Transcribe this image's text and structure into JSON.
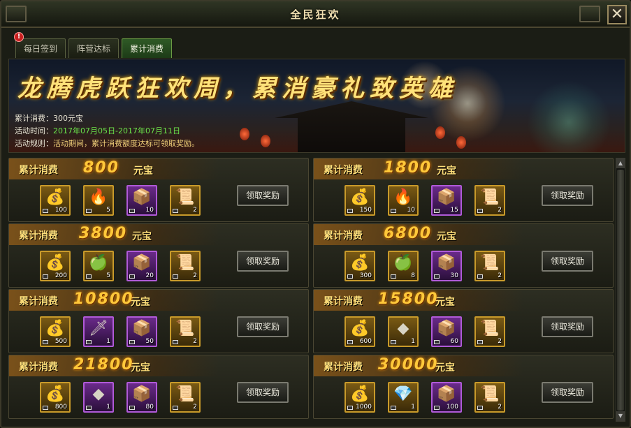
{
  "window": {
    "title": "全民狂欢",
    "close_glyph": "✕"
  },
  "tabs": [
    {
      "label": "每日签到",
      "active": false,
      "alert": true
    },
    {
      "label": "阵营达标",
      "active": false
    },
    {
      "label": "累计消费",
      "active": true
    }
  ],
  "alert_glyph": "!",
  "banner": {
    "title": "龙腾虎跃狂欢周，累消豪礼致英雄",
    "spent_label": "累计消费：",
    "spent_value": "300元宝",
    "time_label": "活动时间：",
    "time_value": "2017年07月05日-2017年07月11日",
    "rule_label": "活动规则：",
    "rule_value": "活动期间，累计消费额度达标可领取奖励。"
  },
  "tier_label": "累计消费",
  "unit": "元宝",
  "claim_label": "领取奖励",
  "tiers": [
    {
      "amount": "800",
      "items": [
        {
          "icon": "gold-ingot-icon",
          "glyph": "💰",
          "count": "100",
          "color": "gold"
        },
        {
          "icon": "fire-orb-icon",
          "glyph": "🔥",
          "count": "5",
          "color": "gold"
        },
        {
          "icon": "crate-icon",
          "glyph": "📦",
          "count": "10",
          "color": "purple"
        },
        {
          "icon": "scroll-icon",
          "glyph": "📜",
          "count": "2",
          "color": "gold"
        }
      ]
    },
    {
      "amount": "1800",
      "items": [
        {
          "icon": "gold-ingot-icon",
          "glyph": "💰",
          "count": "150",
          "color": "gold"
        },
        {
          "icon": "fire-orb-icon",
          "glyph": "🔥",
          "count": "10",
          "color": "gold"
        },
        {
          "icon": "crate-icon",
          "glyph": "📦",
          "count": "15",
          "color": "purple"
        },
        {
          "icon": "scroll-icon",
          "glyph": "📜",
          "count": "2",
          "color": "gold"
        }
      ]
    },
    {
      "amount": "3800",
      "items": [
        {
          "icon": "gold-ingot-icon",
          "glyph": "💰",
          "count": "200",
          "color": "gold"
        },
        {
          "icon": "golden-apple-icon",
          "glyph": "🍏",
          "count": "5",
          "color": "gold"
        },
        {
          "icon": "crate-icon",
          "glyph": "📦",
          "count": "20",
          "color": "purple"
        },
        {
          "icon": "scroll-icon",
          "glyph": "📜",
          "count": "2",
          "color": "gold"
        }
      ]
    },
    {
      "amount": "6800",
      "items": [
        {
          "icon": "gold-ingot-icon",
          "glyph": "💰",
          "count": "300",
          "color": "gold"
        },
        {
          "icon": "golden-apple-icon",
          "glyph": "🍏",
          "count": "8",
          "color": "gold"
        },
        {
          "icon": "crate-icon",
          "glyph": "📦",
          "count": "30",
          "color": "purple"
        },
        {
          "icon": "scroll-icon",
          "glyph": "📜",
          "count": "2",
          "color": "gold"
        }
      ]
    },
    {
      "amount": "10800",
      "items": [
        {
          "icon": "gold-ingot-icon",
          "glyph": "💰",
          "count": "500",
          "color": "gold"
        },
        {
          "icon": "dagger-icon",
          "glyph": "🗡",
          "count": "1",
          "color": "purple"
        },
        {
          "icon": "crate-icon",
          "glyph": "📦",
          "count": "50",
          "color": "purple"
        },
        {
          "icon": "scroll-icon",
          "glyph": "📜",
          "count": "2",
          "color": "gold"
        }
      ]
    },
    {
      "amount": "15800",
      "items": [
        {
          "icon": "gold-ingot-icon",
          "glyph": "💰",
          "count": "600",
          "color": "gold"
        },
        {
          "icon": "silver-cube-icon",
          "glyph": "◆",
          "count": "1",
          "color": "gold"
        },
        {
          "icon": "crate-icon",
          "glyph": "📦",
          "count": "60",
          "color": "purple"
        },
        {
          "icon": "scroll-icon",
          "glyph": "📜",
          "count": "2",
          "color": "gold"
        }
      ]
    },
    {
      "amount": "21800",
      "items": [
        {
          "icon": "gold-ingot-icon",
          "glyph": "💰",
          "count": "800",
          "color": "gold"
        },
        {
          "icon": "blue-crystal-icon",
          "glyph": "◆",
          "count": "1",
          "color": "purple"
        },
        {
          "icon": "crate-icon",
          "glyph": "📦",
          "count": "80",
          "color": "purple"
        },
        {
          "icon": "scroll-icon",
          "glyph": "📜",
          "count": "2",
          "color": "gold"
        }
      ]
    },
    {
      "amount": "30000",
      "items": [
        {
          "icon": "gold-ingot-icon",
          "glyph": "💰",
          "count": "1000",
          "color": "gold"
        },
        {
          "icon": "sapphire-icon",
          "glyph": "💎",
          "count": "1",
          "color": "gold"
        },
        {
          "icon": "crate-icon",
          "glyph": "📦",
          "count": "100",
          "color": "purple"
        },
        {
          "icon": "scroll-icon",
          "glyph": "📜",
          "count": "2",
          "color": "gold"
        }
      ]
    }
  ],
  "scroll": {
    "up_glyph": "▲",
    "down_glyph": "▼"
  }
}
